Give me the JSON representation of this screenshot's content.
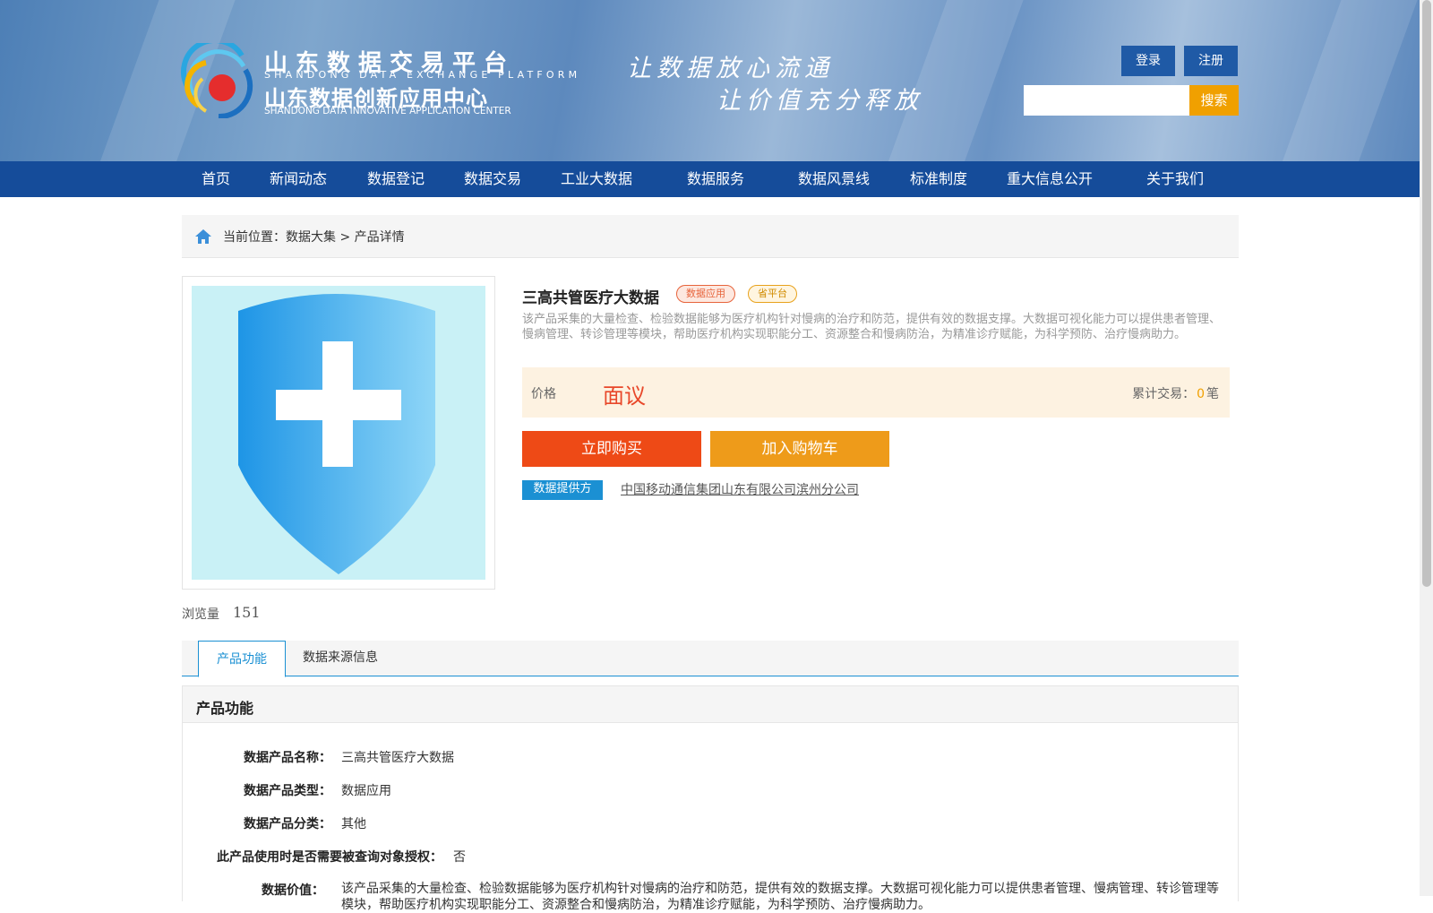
{
  "header": {
    "logo_title_cn": "山东数据交易平台",
    "logo_title_en": "SHANDONG DATA EXCHANGE PLATFORM",
    "logo_subtitle_cn": "山东数据创新应用中心",
    "logo_subtitle_en": "SHANDONG DATA INNOVATIVE APPLICATION CENTER",
    "slogan_line1": "让数据放心流通",
    "slogan_line2": "让价值充分释放",
    "login_label": "登录",
    "register_label": "注册",
    "search_placeholder": "",
    "search_button": "搜索"
  },
  "nav": {
    "items": [
      "首页",
      "新闻动态",
      "数据登记",
      "数据交易",
      "工业大数据",
      "数据服务",
      "数据风景线",
      "标准制度",
      "重大信息公开",
      "关于我们"
    ]
  },
  "breadcrumb": {
    "prefix": "当前位置：",
    "path": "数据大集 > 产品详情"
  },
  "product": {
    "title": "三高共管医疗大数据",
    "tags": [
      "数据应用",
      "省平台"
    ],
    "description": "该产品采集的大量检查、检验数据能够为医疗机构针对慢病的治疗和防范，提供有效的数据支撑。大数据可视化能力可以提供患者管理、慢病管理、转诊管理等模块，帮助医疗机构实现职能分工、资源整合和慢病防治，为精准诊疗赋能，为科学预防、治疗慢病助力。",
    "price_label": "价格",
    "price_value": "面议",
    "trade_label": "累计交易：",
    "trade_count": "0",
    "trade_unit": "笔",
    "buy_button": "立即购买",
    "cart_button": "加入购物车",
    "provider_badge": "数据提供方",
    "provider_name": "中国移动通信集团山东有限公司滨州分公司",
    "views_label": "浏览量",
    "views_count": "151",
    "image_icon": "medical-shield-plus-icon"
  },
  "tabs": [
    "产品功能",
    "数据来源信息"
  ],
  "function_panel": {
    "heading": "产品功能",
    "rows": [
      {
        "label": "数据产品名称：",
        "value": "三高共管医疗大数据"
      },
      {
        "label": "数据产品类型：",
        "value": "数据应用"
      },
      {
        "label": "数据产品分类：",
        "value": "其他"
      },
      {
        "label": "此产品使用时是否需要被查询对象授权：",
        "value": "否"
      },
      {
        "label": "数据价值：",
        "value": "该产品采集的大量检查、检验数据能够为医疗机构针对慢病的治疗和防范，提供有效的数据支撑。大数据可视化能力可以提供患者管理、慢病管理、转诊管理等模块，帮助医疗机构实现职能分工、资源整合和慢病防治，为精准诊疗赋能，为科学预防、治疗慢病助力。"
      }
    ]
  },
  "colors": {
    "nav_bg": "#154c9a",
    "accent_blue": "#1b90d3",
    "buy_orange": "#ee4a16",
    "cart_orange": "#ee9b1a",
    "search_orange": "#f0a000",
    "price_red": "#e8482a"
  }
}
